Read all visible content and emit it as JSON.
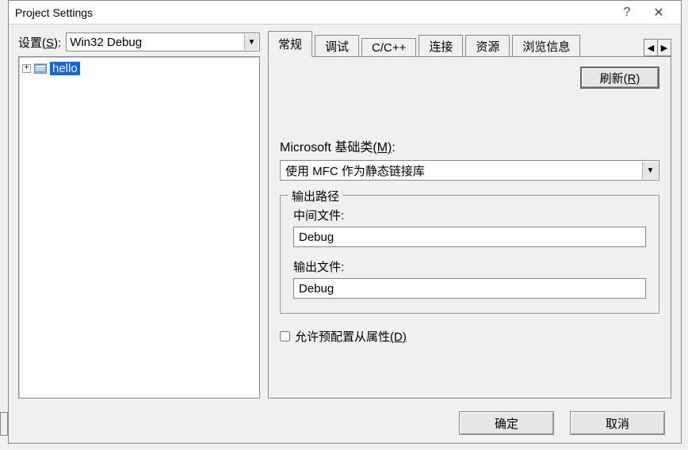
{
  "window": {
    "title": "Project Settings"
  },
  "titlebar": {
    "help": "?",
    "close": "✕"
  },
  "left": {
    "setting_label_pre": "设置",
    "setting_label_hot": "(S)",
    "setting_label_post": ":",
    "setting_value": "Win32 Debug",
    "tree_item": "hello",
    "expander": "+"
  },
  "tabs": {
    "items": [
      "常规",
      "调试",
      "C/C++",
      "连接",
      "资源",
      "浏览信息"
    ],
    "left_arrow": "◀",
    "right_arrow": "▶",
    "active_index": 0
  },
  "panel": {
    "refresh_label_pre": "刷新",
    "refresh_label_hot": "(R)",
    "mfc_label_pre": "Microsoft 基础类",
    "mfc_label_hot": "(M)",
    "mfc_label_post": ":",
    "mfc_value": "使用 MFC 作为静态链接库",
    "output_group": "输出路径",
    "intermediate_label": "中间文件:",
    "intermediate_value": "Debug",
    "outputfile_label": "输出文件:",
    "outputfile_value": "Debug",
    "allow_checkbox_pre": "允许预配置从属性",
    "allow_checkbox_hot": "(D)",
    "allow_checked": false
  },
  "footer": {
    "ok": "确定",
    "cancel": "取消"
  },
  "combo_arrow": "▼"
}
